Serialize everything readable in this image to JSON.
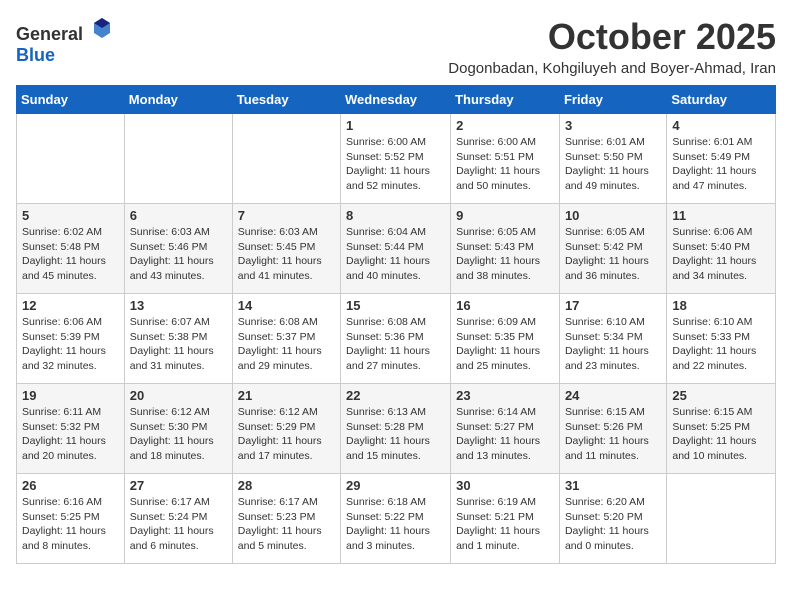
{
  "header": {
    "logo_general": "General",
    "logo_blue": "Blue",
    "month_year": "October 2025",
    "location": "Dogonbadan, Kohgiluyeh and Boyer-Ahmad, Iran"
  },
  "columns": [
    "Sunday",
    "Monday",
    "Tuesday",
    "Wednesday",
    "Thursday",
    "Friday",
    "Saturday"
  ],
  "weeks": [
    [
      {
        "day": "",
        "info": ""
      },
      {
        "day": "",
        "info": ""
      },
      {
        "day": "",
        "info": ""
      },
      {
        "day": "1",
        "info": "Sunrise: 6:00 AM\nSunset: 5:52 PM\nDaylight: 11 hours\nand 52 minutes."
      },
      {
        "day": "2",
        "info": "Sunrise: 6:00 AM\nSunset: 5:51 PM\nDaylight: 11 hours\nand 50 minutes."
      },
      {
        "day": "3",
        "info": "Sunrise: 6:01 AM\nSunset: 5:50 PM\nDaylight: 11 hours\nand 49 minutes."
      },
      {
        "day": "4",
        "info": "Sunrise: 6:01 AM\nSunset: 5:49 PM\nDaylight: 11 hours\nand 47 minutes."
      }
    ],
    [
      {
        "day": "5",
        "info": "Sunrise: 6:02 AM\nSunset: 5:48 PM\nDaylight: 11 hours\nand 45 minutes."
      },
      {
        "day": "6",
        "info": "Sunrise: 6:03 AM\nSunset: 5:46 PM\nDaylight: 11 hours\nand 43 minutes."
      },
      {
        "day": "7",
        "info": "Sunrise: 6:03 AM\nSunset: 5:45 PM\nDaylight: 11 hours\nand 41 minutes."
      },
      {
        "day": "8",
        "info": "Sunrise: 6:04 AM\nSunset: 5:44 PM\nDaylight: 11 hours\nand 40 minutes."
      },
      {
        "day": "9",
        "info": "Sunrise: 6:05 AM\nSunset: 5:43 PM\nDaylight: 11 hours\nand 38 minutes."
      },
      {
        "day": "10",
        "info": "Sunrise: 6:05 AM\nSunset: 5:42 PM\nDaylight: 11 hours\nand 36 minutes."
      },
      {
        "day": "11",
        "info": "Sunrise: 6:06 AM\nSunset: 5:40 PM\nDaylight: 11 hours\nand 34 minutes."
      }
    ],
    [
      {
        "day": "12",
        "info": "Sunrise: 6:06 AM\nSunset: 5:39 PM\nDaylight: 11 hours\nand 32 minutes."
      },
      {
        "day": "13",
        "info": "Sunrise: 6:07 AM\nSunset: 5:38 PM\nDaylight: 11 hours\nand 31 minutes."
      },
      {
        "day": "14",
        "info": "Sunrise: 6:08 AM\nSunset: 5:37 PM\nDaylight: 11 hours\nand 29 minutes."
      },
      {
        "day": "15",
        "info": "Sunrise: 6:08 AM\nSunset: 5:36 PM\nDaylight: 11 hours\nand 27 minutes."
      },
      {
        "day": "16",
        "info": "Sunrise: 6:09 AM\nSunset: 5:35 PM\nDaylight: 11 hours\nand 25 minutes."
      },
      {
        "day": "17",
        "info": "Sunrise: 6:10 AM\nSunset: 5:34 PM\nDaylight: 11 hours\nand 23 minutes."
      },
      {
        "day": "18",
        "info": "Sunrise: 6:10 AM\nSunset: 5:33 PM\nDaylight: 11 hours\nand 22 minutes."
      }
    ],
    [
      {
        "day": "19",
        "info": "Sunrise: 6:11 AM\nSunset: 5:32 PM\nDaylight: 11 hours\nand 20 minutes."
      },
      {
        "day": "20",
        "info": "Sunrise: 6:12 AM\nSunset: 5:30 PM\nDaylight: 11 hours\nand 18 minutes."
      },
      {
        "day": "21",
        "info": "Sunrise: 6:12 AM\nSunset: 5:29 PM\nDaylight: 11 hours\nand 17 minutes."
      },
      {
        "day": "22",
        "info": "Sunrise: 6:13 AM\nSunset: 5:28 PM\nDaylight: 11 hours\nand 15 minutes."
      },
      {
        "day": "23",
        "info": "Sunrise: 6:14 AM\nSunset: 5:27 PM\nDaylight: 11 hours\nand 13 minutes."
      },
      {
        "day": "24",
        "info": "Sunrise: 6:15 AM\nSunset: 5:26 PM\nDaylight: 11 hours\nand 11 minutes."
      },
      {
        "day": "25",
        "info": "Sunrise: 6:15 AM\nSunset: 5:25 PM\nDaylight: 11 hours\nand 10 minutes."
      }
    ],
    [
      {
        "day": "26",
        "info": "Sunrise: 6:16 AM\nSunset: 5:25 PM\nDaylight: 11 hours\nand 8 minutes."
      },
      {
        "day": "27",
        "info": "Sunrise: 6:17 AM\nSunset: 5:24 PM\nDaylight: 11 hours\nand 6 minutes."
      },
      {
        "day": "28",
        "info": "Sunrise: 6:17 AM\nSunset: 5:23 PM\nDaylight: 11 hours\nand 5 minutes."
      },
      {
        "day": "29",
        "info": "Sunrise: 6:18 AM\nSunset: 5:22 PM\nDaylight: 11 hours\nand 3 minutes."
      },
      {
        "day": "30",
        "info": "Sunrise: 6:19 AM\nSunset: 5:21 PM\nDaylight: 11 hours\nand 1 minute."
      },
      {
        "day": "31",
        "info": "Sunrise: 6:20 AM\nSunset: 5:20 PM\nDaylight: 11 hours\nand 0 minutes."
      },
      {
        "day": "",
        "info": ""
      }
    ]
  ]
}
